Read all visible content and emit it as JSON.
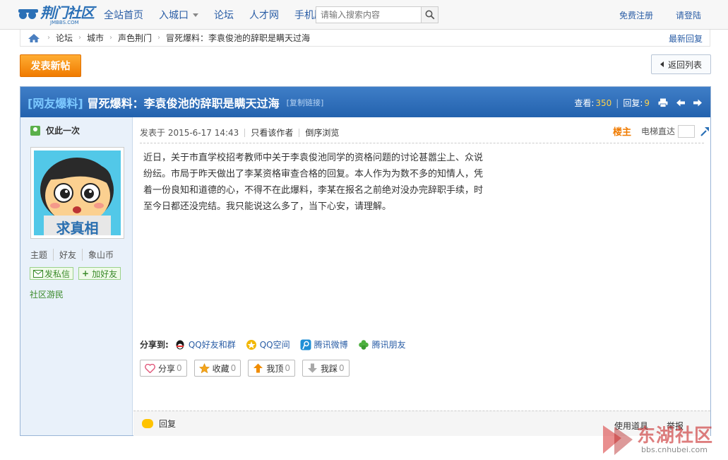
{
  "site": {
    "logo_text": "荆门社区",
    "logo_sub": "JMBBS.COM"
  },
  "nav": {
    "items": [
      "全站首页",
      "入城口",
      "论坛",
      "人才网",
      "手机版"
    ]
  },
  "search": {
    "placeholder": "请输入搜索内容"
  },
  "topright": {
    "register": "免费注册",
    "login": "请登陆"
  },
  "breadcrumb": {
    "items": [
      "论坛",
      "城市",
      "声色荆门",
      "冒死爆料：李袁俊池的辞职是瞒天过海"
    ],
    "right_link": "最新回复"
  },
  "toolbar": {
    "post_label": "发表新帖",
    "back_label": "返回列表"
  },
  "thread": {
    "tag": "[网友爆料]",
    "title": "冒死爆料：李袁俊池的辞职是瞒天过海",
    "copy_link": "[复制链接]",
    "views_label": "查看:",
    "views": "350",
    "replies_label": "回复:",
    "replies": "9"
  },
  "author": {
    "online_label": "仅此一次",
    "avatar_text": "求真相",
    "stats": [
      "主题",
      "好友",
      "象山币"
    ],
    "pm_label": "发私信",
    "add_friend_label": "加好友",
    "group": "社区游民"
  },
  "post": {
    "posted_at": "发表于 2015-6-17 14:43",
    "only_author": "只看该作者",
    "reverse": "倒序浏览",
    "floor": "楼主",
    "jump_label": "电梯直达",
    "lines": [
      "近日，关于市直学校招考教师中关于李袁俊池同学的资格问题的讨论甚嚣尘上、众说",
      "纷纭。市局于昨天做出了李某资格审查合格的回复。本人作为为数不多的知情人，凭",
      "着一份良知和道德的心，不得不在此爆料，李某在报名之前绝对没办完辞职手续，时",
      "至今日都还没完结。我只能说这么多了，当下心安，请理解。"
    ]
  },
  "share": {
    "label": "分享到:",
    "items": [
      "QQ好友和群",
      "QQ空间",
      "腾讯微博",
      "腾讯朋友"
    ],
    "colors": [
      "#1a1a1a",
      "#f2b705",
      "#1f8fd6",
      "#4caf3e"
    ]
  },
  "actions": {
    "share": {
      "label": "分享",
      "count": "0"
    },
    "fav": {
      "label": "收藏",
      "count": "0"
    },
    "up": {
      "label": "我顶",
      "count": "0"
    },
    "down": {
      "label": "我踩",
      "count": "0"
    }
  },
  "replybar": {
    "reply": "回复",
    "tools": "使用道具",
    "report": "举报"
  },
  "watermark": {
    "main": "东湖社区",
    "sub": "bbs.cnhubei.com"
  },
  "colors": {
    "brand_blue": "#2b70b6",
    "title_bar": "#2362ae",
    "post_orange": "#f07b00",
    "link_blue": "#2b5ea6"
  }
}
